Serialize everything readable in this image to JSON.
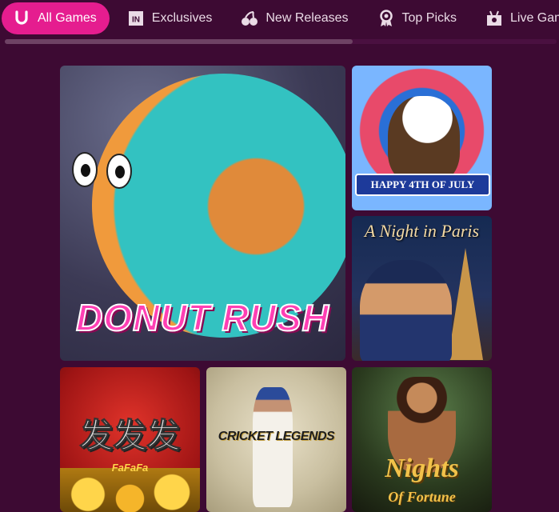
{
  "nav": {
    "tabs": [
      {
        "label": "All Games",
        "icon": "horseshoe-icon",
        "active": true
      },
      {
        "label": "Exclusives",
        "icon": "exclusive-badge-icon",
        "active": false
      },
      {
        "label": "New Releases",
        "icon": "cherries-icon",
        "active": false
      },
      {
        "label": "Top Picks",
        "icon": "award-ribbon-icon",
        "active": false
      },
      {
        "label": "Live Games",
        "icon": "live-table-icon",
        "active": false
      }
    ]
  },
  "games": {
    "donut_rush": {
      "title": "DONUT RUSH"
    },
    "july": {
      "title": "HAPPY 4TH OF JULY"
    },
    "paris": {
      "title": "A Night in Paris"
    },
    "fafafa": {
      "title": "发发发",
      "subtitle": "FaFaFa"
    },
    "cricket": {
      "title": "CRICKET LEGENDS"
    },
    "nights": {
      "title": "Nights",
      "subtitle": "Of Fortune"
    }
  },
  "colors": {
    "background": "#3d0a33",
    "active_tab": "#e51d8f",
    "tab_text": "#eadbe6"
  }
}
